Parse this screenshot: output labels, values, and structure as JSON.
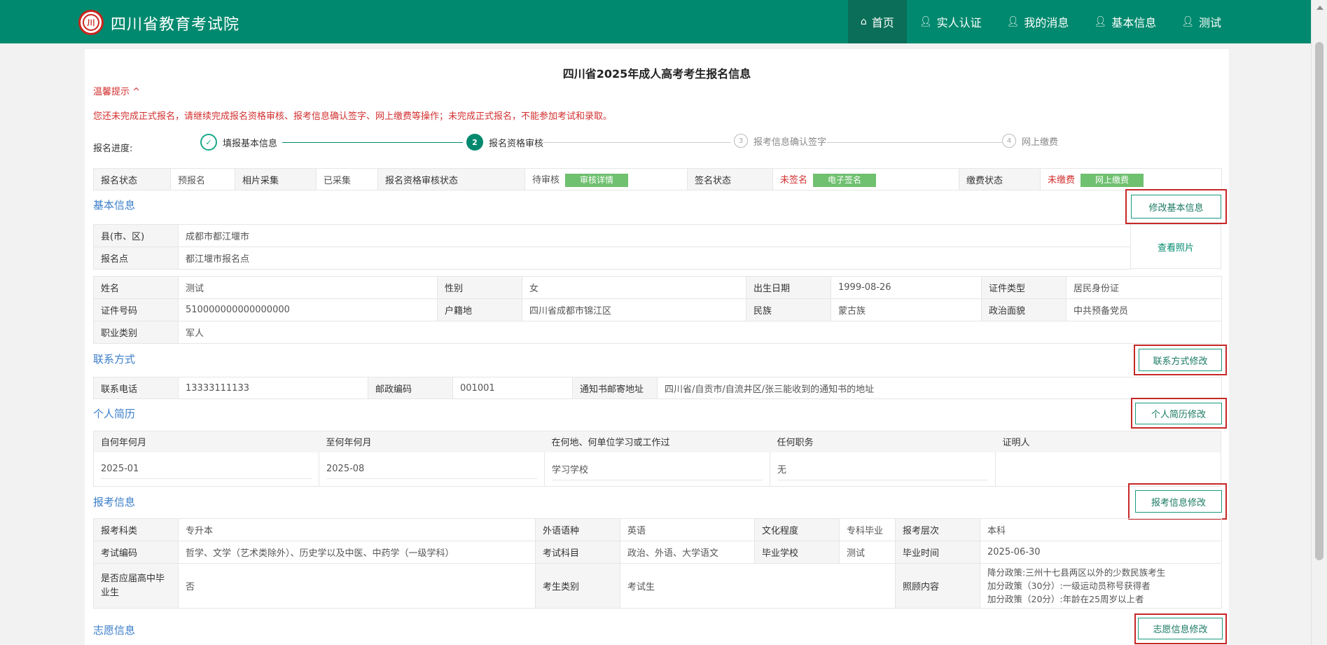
{
  "header": {
    "brand": "四川省教育考试院",
    "logo_text": "川",
    "nav": [
      {
        "label": "首页",
        "icon": "home-icon"
      },
      {
        "label": "实人认证",
        "icon": "user-icon"
      },
      {
        "label": "我的消息",
        "icon": "user-icon"
      },
      {
        "label": "基本信息",
        "icon": "user-icon"
      },
      {
        "label": "测试",
        "icon": "user-icon"
      }
    ]
  },
  "page": {
    "title": "四川省2025年成人高考考生报名信息",
    "tip_title": "温馨提示 ^",
    "tip_text": "您还未完成正式报名，请继续完成报名资格审核、报考信息确认签字、网上缴费等操作；未完成正式报名，不能参加考试和录取。"
  },
  "progress": {
    "label": "报名进度:",
    "steps": [
      {
        "num": "✓",
        "label": "填报基本信息"
      },
      {
        "num": "2",
        "label": "报名资格审核"
      },
      {
        "num": "3",
        "label": "报考信息确认签字"
      },
      {
        "num": "4",
        "label": "网上缴费"
      }
    ]
  },
  "status": {
    "reg_label": "报名状态",
    "reg_value": "预报名",
    "photo_label": "相片采集",
    "photo_value": "已采集",
    "audit_label": "报名资格审核状态",
    "audit_value": "待审核",
    "audit_btn": "审核详情",
    "sign_label": "签名状态",
    "sign_value": "未签名",
    "sign_btn": "电子签名",
    "pay_label": "缴费状态",
    "pay_value": "未缴费",
    "pay_btn": "网上缴费"
  },
  "basic": {
    "section": "基本信息",
    "edit_btn": "修改基本信息",
    "county_label": "县(市、区)",
    "county_value": "成都市都江堰市",
    "site_label": "报名点",
    "site_value": "都江堰市报名点",
    "photo_link": "查看照片",
    "name_label": "姓名",
    "name_value": "测试",
    "gender_label": "性别",
    "gender_value": "女",
    "birth_label": "出生日期",
    "birth_value": "1999-08-26",
    "idtype_label": "证件类型",
    "idtype_value": "居民身份证",
    "idno_label": "证件号码",
    "idno_value": "510000000000000000",
    "hukou_label": "户籍地",
    "hukou_value": "四川省成都市锦江区",
    "nation_label": "民族",
    "nation_value": "蒙古族",
    "political_label": "政治面貌",
    "political_value": "中共预备党员",
    "job_label": "职业类别",
    "job_value": "军人"
  },
  "contact": {
    "section": "联系方式",
    "edit_btn": "联系方式修改",
    "phone_label": "联系电话",
    "phone_value": "13333111133",
    "zip_label": "邮政编码",
    "zip_value": "001001",
    "addr_label": "通知书邮寄地址",
    "addr_value": "四川省/自贡市/自流井区/张三能收到的通知书的地址"
  },
  "resume": {
    "section": "个人简历",
    "edit_btn": "个人简历修改",
    "headers": [
      "自何年何月",
      "至何年何月",
      "在何地、何单位学习或工作过",
      "任何职务",
      "证明人"
    ],
    "rows": [
      [
        "2025-01",
        "2025-08",
        "学习学校",
        "无",
        ""
      ]
    ]
  },
  "exam": {
    "section": "报考信息",
    "edit_btn": "报考信息修改",
    "subject_label": "报考科类",
    "subject_value": "专升本",
    "lang_label": "外语语种",
    "lang_value": "英语",
    "edu_label": "文化程度",
    "edu_value": "专科毕业",
    "level_label": "报考层次",
    "level_value": "本科",
    "code_label": "考试编码",
    "code_value": "哲学、文学（艺术类除外）、历史学以及中医、中药学（一级学科）",
    "course_label": "考试科目",
    "course_value": "政治、外语、大学语文",
    "school_label": "毕业学校",
    "school_value": "测试",
    "gradtime_label": "毕业时间",
    "gradtime_value": "2025-06-30",
    "fresh_label": "是否应届高中毕业生",
    "fresh_value": "否",
    "type_label": "考生类别",
    "type_value": "考试生",
    "care_label": "照顾内容",
    "care_lines": [
      "降分政策:三州十七县两区以外的少数民族考生",
      "加分政策（30分）:一级运动员称号获得者",
      "加分政策（20分）:年龄在25周岁以上者"
    ]
  },
  "wish": {
    "section": "志愿信息",
    "edit_btn": "志愿信息修改"
  }
}
